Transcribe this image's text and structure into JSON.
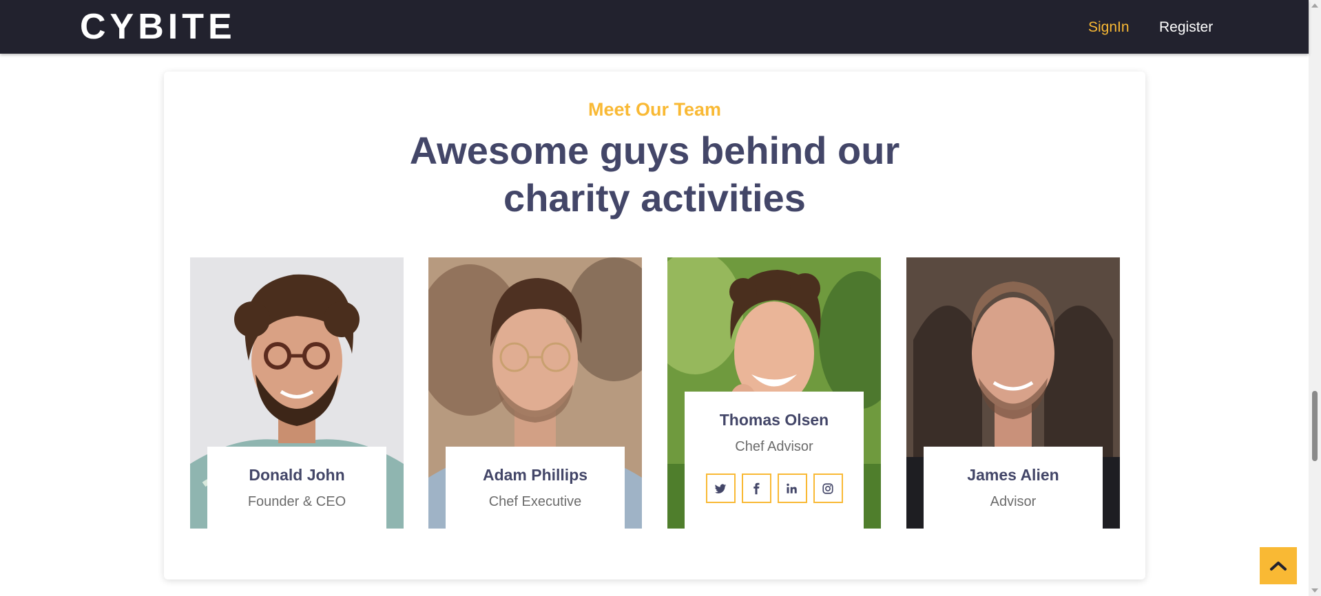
{
  "navbar": {
    "brand": "CYBITE",
    "signin_label": "SignIn",
    "register_label": "Register"
  },
  "team": {
    "eyebrow": "Meet Our Team",
    "headline_line1": "Awesome guys behind our",
    "headline_line2": "charity activities",
    "members": [
      {
        "name": "Donald John",
        "role": "Founder & CEO"
      },
      {
        "name": "Adam Phillips",
        "role": "Chef Executive"
      },
      {
        "name": "Thomas Olsen",
        "role": "Chef Advisor"
      },
      {
        "name": "James Alien",
        "role": "Advisor"
      }
    ],
    "social_icons": [
      "twitter-icon",
      "facebook-icon",
      "linkedin-icon",
      "instagram-icon"
    ]
  },
  "colors": {
    "accent": "#f9b934",
    "navbar_bg": "#22222e",
    "heading": "#434668",
    "subtext": "#6b6b6b"
  },
  "back_to_top_icon": "chevron-up-icon"
}
